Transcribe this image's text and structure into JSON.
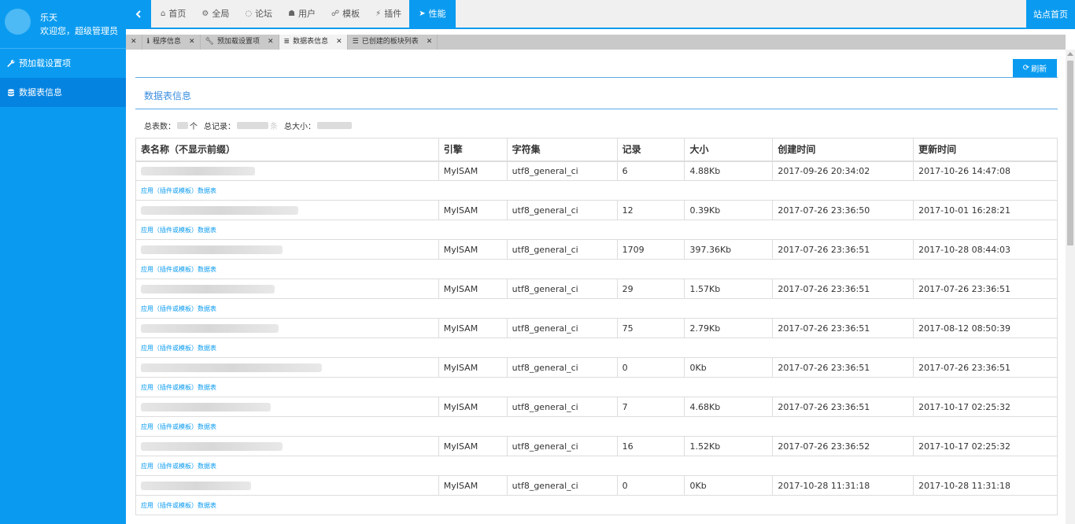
{
  "user": {
    "name": "乐天",
    "welcome": "欢迎您，超级管理员"
  },
  "sidebar": {
    "items": [
      {
        "label": "预加载设置项",
        "icon": "wrench-icon",
        "active": false
      },
      {
        "label": "数据表信息",
        "icon": "database-icon",
        "active": true
      }
    ]
  },
  "topnav": {
    "items": [
      {
        "label": "首页",
        "icon": "home-icon"
      },
      {
        "label": "全局",
        "icon": "gears-icon"
      },
      {
        "label": "论坛",
        "icon": "comments-icon"
      },
      {
        "label": "用户",
        "icon": "users-icon"
      },
      {
        "label": "模板",
        "icon": "sitemap-icon"
      },
      {
        "label": "插件",
        "icon": "plug-icon"
      },
      {
        "label": "性能",
        "icon": "paper-plane-icon"
      }
    ],
    "site_home": "站点首页"
  },
  "tabs": [
    {
      "label": "程序信息",
      "icon": "info-icon"
    },
    {
      "label": "预加载设置项",
      "icon": "wrench-icon"
    },
    {
      "label": "数据表信息",
      "icon": "database-icon"
    },
    {
      "label": "已创建的板块列表",
      "icon": "list-icon"
    }
  ],
  "toolbar": {
    "refresh_label": "刷新"
  },
  "section": {
    "title": "数据表信息"
  },
  "summary": {
    "tables_label": "总表数：",
    "tables_unit": "个",
    "records_label": "总记录：",
    "records_unit": "条",
    "size_label": "总大小："
  },
  "table": {
    "headers": [
      "表名称（不显示前缀）",
      "引擎",
      "字符集",
      "记录",
      "大小",
      "创建时间",
      "更新时间"
    ],
    "sub_label": "应用（插件或模板）数据表",
    "rows": [
      {
        "engine": "MyISAM",
        "charset": "utf8_general_ci",
        "records": "6",
        "size": "4.88Kb",
        "created": "2017-09-26 20:34:02",
        "updated": "2017-10-26 14:47:08"
      },
      {
        "engine": "MyISAM",
        "charset": "utf8_general_ci",
        "records": "12",
        "size": "0.39Kb",
        "created": "2017-07-26 23:36:50",
        "updated": "2017-10-01 16:28:21"
      },
      {
        "engine": "MyISAM",
        "charset": "utf8_general_ci",
        "records": "1709",
        "size": "397.36Kb",
        "created": "2017-07-26 23:36:51",
        "updated": "2017-10-28 08:44:03"
      },
      {
        "engine": "MyISAM",
        "charset": "utf8_general_ci",
        "records": "29",
        "size": "1.57Kb",
        "created": "2017-07-26 23:36:51",
        "updated": "2017-07-26 23:36:51"
      },
      {
        "engine": "MyISAM",
        "charset": "utf8_general_ci",
        "records": "75",
        "size": "2.79Kb",
        "created": "2017-07-26 23:36:51",
        "updated": "2017-08-12 08:50:39"
      },
      {
        "engine": "MyISAM",
        "charset": "utf8_general_ci",
        "records": "0",
        "size": "0Kb",
        "created": "2017-07-26 23:36:51",
        "updated": "2017-07-26 23:36:51"
      },
      {
        "engine": "MyISAM",
        "charset": "utf8_general_ci",
        "records": "7",
        "size": "4.68Kb",
        "created": "2017-07-26 23:36:51",
        "updated": "2017-10-17 02:25:32"
      },
      {
        "engine": "MyISAM",
        "charset": "utf8_general_ci",
        "records": "16",
        "size": "1.52Kb",
        "created": "2017-07-26 23:36:52",
        "updated": "2017-10-17 02:25:32"
      },
      {
        "engine": "MyISAM",
        "charset": "utf8_general_ci",
        "records": "0",
        "size": "0Kb",
        "created": "2017-10-28 11:31:18",
        "updated": "2017-10-28 11:31:18"
      }
    ]
  },
  "colors": {
    "accent": "#0a9bf0",
    "sidebar_active": "#0583e0",
    "link": "#0a9bf0",
    "title": "#3c8ede"
  }
}
